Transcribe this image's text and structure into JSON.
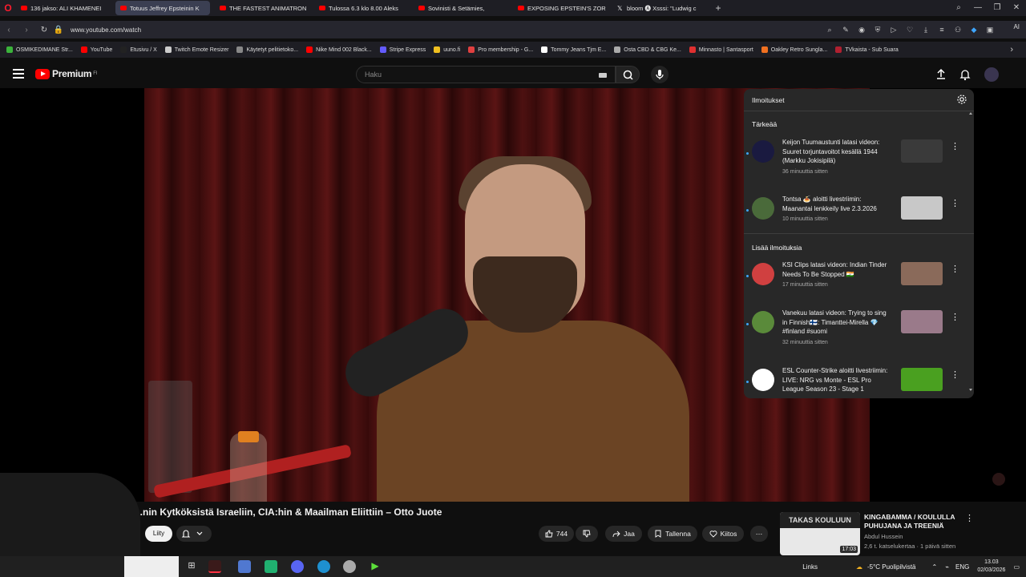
{
  "browser": {
    "tabs": [
      {
        "label": "136 jakso: ALI KHAMENEI",
        "icon": "youtube-icon"
      },
      {
        "label": "Totuus Jeffrey Epsteinin K",
        "icon": "youtube-icon",
        "active": true
      },
      {
        "label": "THE FASTEST ANIMATRON",
        "icon": "youtube-icon"
      },
      {
        "label": "Tulossa 6.3 klo 8.00 Aleks",
        "icon": "youtube-icon"
      },
      {
        "label": "Sovinisti & Setämies,",
        "icon": "youtube-icon"
      },
      {
        "label": "EXPOSING EPSTEIN'S ZOR",
        "icon": "youtube-icon"
      },
      {
        "label": "bloom 🅐 Xsssi: \"Ludwig c",
        "icon": "x-icon"
      }
    ],
    "url": "www.youtube.com/watch",
    "ai_label": "AI",
    "bookmarks": [
      {
        "label": "OSMIKEDIMANE Str...",
        "color": "#3bb33b"
      },
      {
        "label": "YouTube",
        "color": "#ff0000"
      },
      {
        "label": "Etusivu / X",
        "color": "#222222"
      },
      {
        "label": "Twitch Emote Resizer",
        "color": "#cccccc"
      },
      {
        "label": "Käytetyt pelitietoko...",
        "color": "#888888"
      },
      {
        "label": "Nike Mind 002 Black...",
        "color": "#ff0000"
      },
      {
        "label": "Stripe Express",
        "color": "#635bff"
      },
      {
        "label": "uuno.fi",
        "color": "#f0c020"
      },
      {
        "label": "Pro membership - G...",
        "color": "#e04040"
      },
      {
        "label": "Tommy Jeans Tjm E...",
        "color": "#ffffff"
      },
      {
        "label": "Osta CBD & CBG Ke...",
        "color": "#aaaaaa"
      },
      {
        "label": "Minnasto | Santasport",
        "color": "#e03030"
      },
      {
        "label": "Oakley Retro Sungla...",
        "color": "#f07020"
      },
      {
        "label": "TVkaista - Sub Suara",
        "color": "#b02030"
      }
    ]
  },
  "youtube": {
    "logo_text": "Premium",
    "logo_region": "FI",
    "search_placeholder": "Haku"
  },
  "notifications": {
    "title": "Ilmoitukset",
    "section_important": "Tärkeää",
    "section_more": "Lisää ilmoituksia",
    "items": [
      {
        "text": "Keijon Tuumaustunti latasi videon: Suuret torjuntavoitot kesällä 1944 (Markku Jokisipilä)",
        "time": "36 minuuttia sitten",
        "avatar_color": "#1a1a40",
        "thumb_color": "#3a3a3a"
      },
      {
        "text": "Tontsa 🍝 aloitti livestriimin: Maanantai lenkkeily live 2.3.2026",
        "time": "10 minuuttia sitten",
        "avatar_color": "#4a6a3a",
        "thumb_color": "#c8c8c8"
      },
      {
        "text": "KSI Clips latasi videon: Indian Tinder Needs To Be Stopped 🇮🇳",
        "time": "17 minuuttia sitten",
        "avatar_color": "#d04040",
        "thumb_color": "#8a6a5a"
      },
      {
        "text": "Vanekuu latasi videon: Trying to sing in Finnish🇫🇮: Timanttei-Mirella 💎 #finland #suomi",
        "time": "32 minuuttia sitten",
        "avatar_color": "#5a8a3a",
        "thumb_color": "#9a7a8a"
      },
      {
        "text": "ESL Counter-Strike aloitti livestriimin: LIVE: NRG vs Monte - ESL Pro League Season 23 - Stage 1",
        "time": "",
        "avatar_color": "#ffffff",
        "thumb_color": "#4aa020"
      }
    ]
  },
  "video": {
    "title": "...nin Kytköksistä Israeliin, CIA:hin & Maailman Eliittiin – Otto Juote",
    "join_label": "Liity",
    "like_count": "744",
    "share_label": "Jaa",
    "save_label": "Tallenna",
    "thanks_label": "Kiitos"
  },
  "recommendation": {
    "thumb_text": "TAKAS KOULUUN",
    "duration": "17:03",
    "title": "KINGABAMMA / KOULULLA PUHUJANA JA TREENIÄ",
    "channel": "Abdul Hussein",
    "meta": "2,6 t. katselukertaa · 1 päivä sitten"
  },
  "taskbar": {
    "links_label": "Links",
    "weather": "-5°C  Puolipilvistä",
    "language": "ENG",
    "time": "13.03",
    "date": "02/03/2026"
  }
}
